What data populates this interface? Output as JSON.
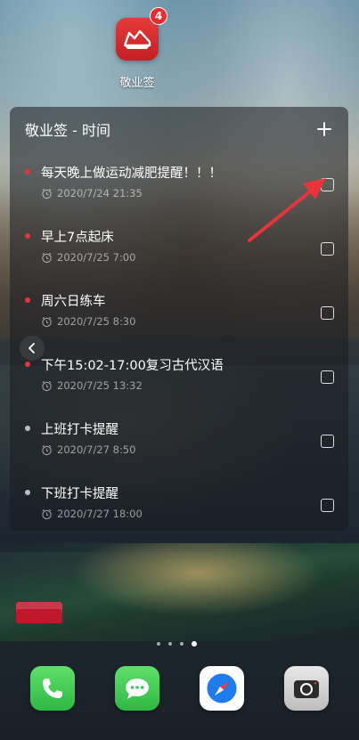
{
  "app": {
    "name": "敬业签",
    "badge": "4"
  },
  "widget": {
    "title": "敬业签 - 时间",
    "add_icon": "plus-icon",
    "tasks": [
      {
        "title": "每天晚上做运动减肥提醒！！！",
        "time": "2020/7/24 21:35",
        "dot_color": "#e8353b",
        "checked": false
      },
      {
        "title": "早上7点起床",
        "time": "2020/7/25 7:00",
        "dot_color": "#e8353b",
        "checked": false
      },
      {
        "title": "周六日练车",
        "time": "2020/7/25 8:30",
        "dot_color": "#e8353b",
        "checked": false
      },
      {
        "title": "下午15:02-17:00复习古代汉语",
        "time": "2020/7/25 13:32",
        "dot_color": "#e8353b",
        "checked": false
      },
      {
        "title": "上班打卡提醒",
        "time": "2020/7/27 8:50",
        "dot_color": "#bfbfbf",
        "checked": false
      },
      {
        "title": "下班打卡提醒",
        "time": "2020/7/27 18:00",
        "dot_color": "#bfbfbf",
        "checked": false
      }
    ]
  },
  "annotation": {
    "arrow_color": "#e8353b"
  },
  "pager": {
    "pages": 4,
    "active": 4
  },
  "dock": [
    {
      "name": "phone",
      "icon": "phone-icon",
      "color": "#34c759"
    },
    {
      "name": "messages",
      "icon": "message-icon",
      "color": "#34c759"
    },
    {
      "name": "browser",
      "icon": "compass-icon",
      "color": "#ffffff"
    },
    {
      "name": "camera",
      "icon": "camera-icon",
      "color": "#d9d9d9"
    }
  ]
}
